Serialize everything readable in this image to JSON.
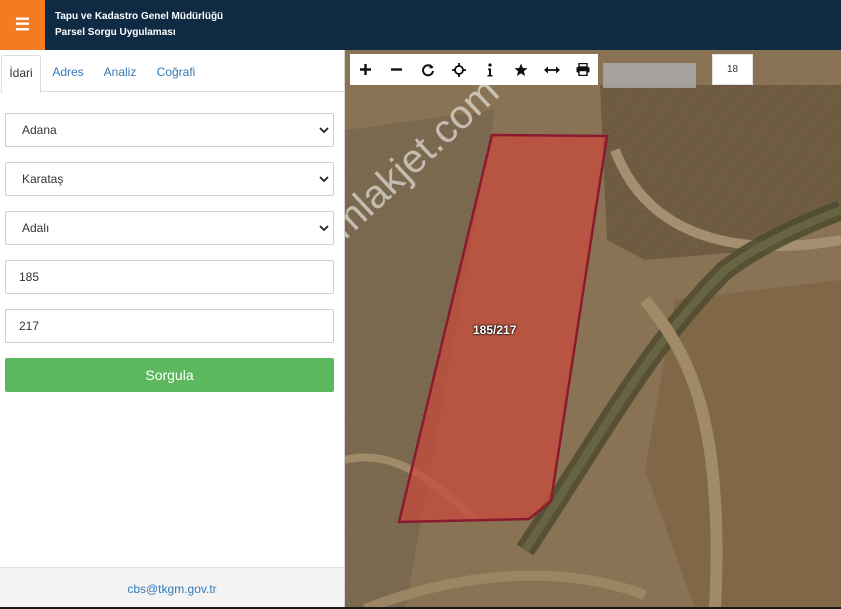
{
  "header": {
    "menu_icon": "hamburger-icon",
    "title_line1": "Tapu ve Kadastro Genel Müdürlüğü",
    "title_line2": "Parsel Sorgu Uygulaması",
    "bg_color": "#0f2a43",
    "menu_color": "#f47b20"
  },
  "tabs": [
    "İdari",
    "Adres",
    "Analiz",
    "Coğrafi"
  ],
  "form": {
    "province": "Adana",
    "district": "Karataş",
    "neighborhood": "Adalı",
    "block": "185",
    "parcel": "217",
    "submit_label": "Sorgula",
    "submit_color": "#5cb85c"
  },
  "footer": {
    "email": "cbs@tkgm.gov.tr"
  },
  "map": {
    "toolbar_icons": [
      "zoom-in-icon",
      "zoom-out-icon",
      "refresh-icon",
      "locate-icon",
      "info-icon",
      "star-icon",
      "measure-icon",
      "print-icon"
    ],
    "zoom_level": "18",
    "parcel_label": "185/217",
    "parcel_color": "#8b1a2e",
    "watermark": "emlakjet.com"
  }
}
